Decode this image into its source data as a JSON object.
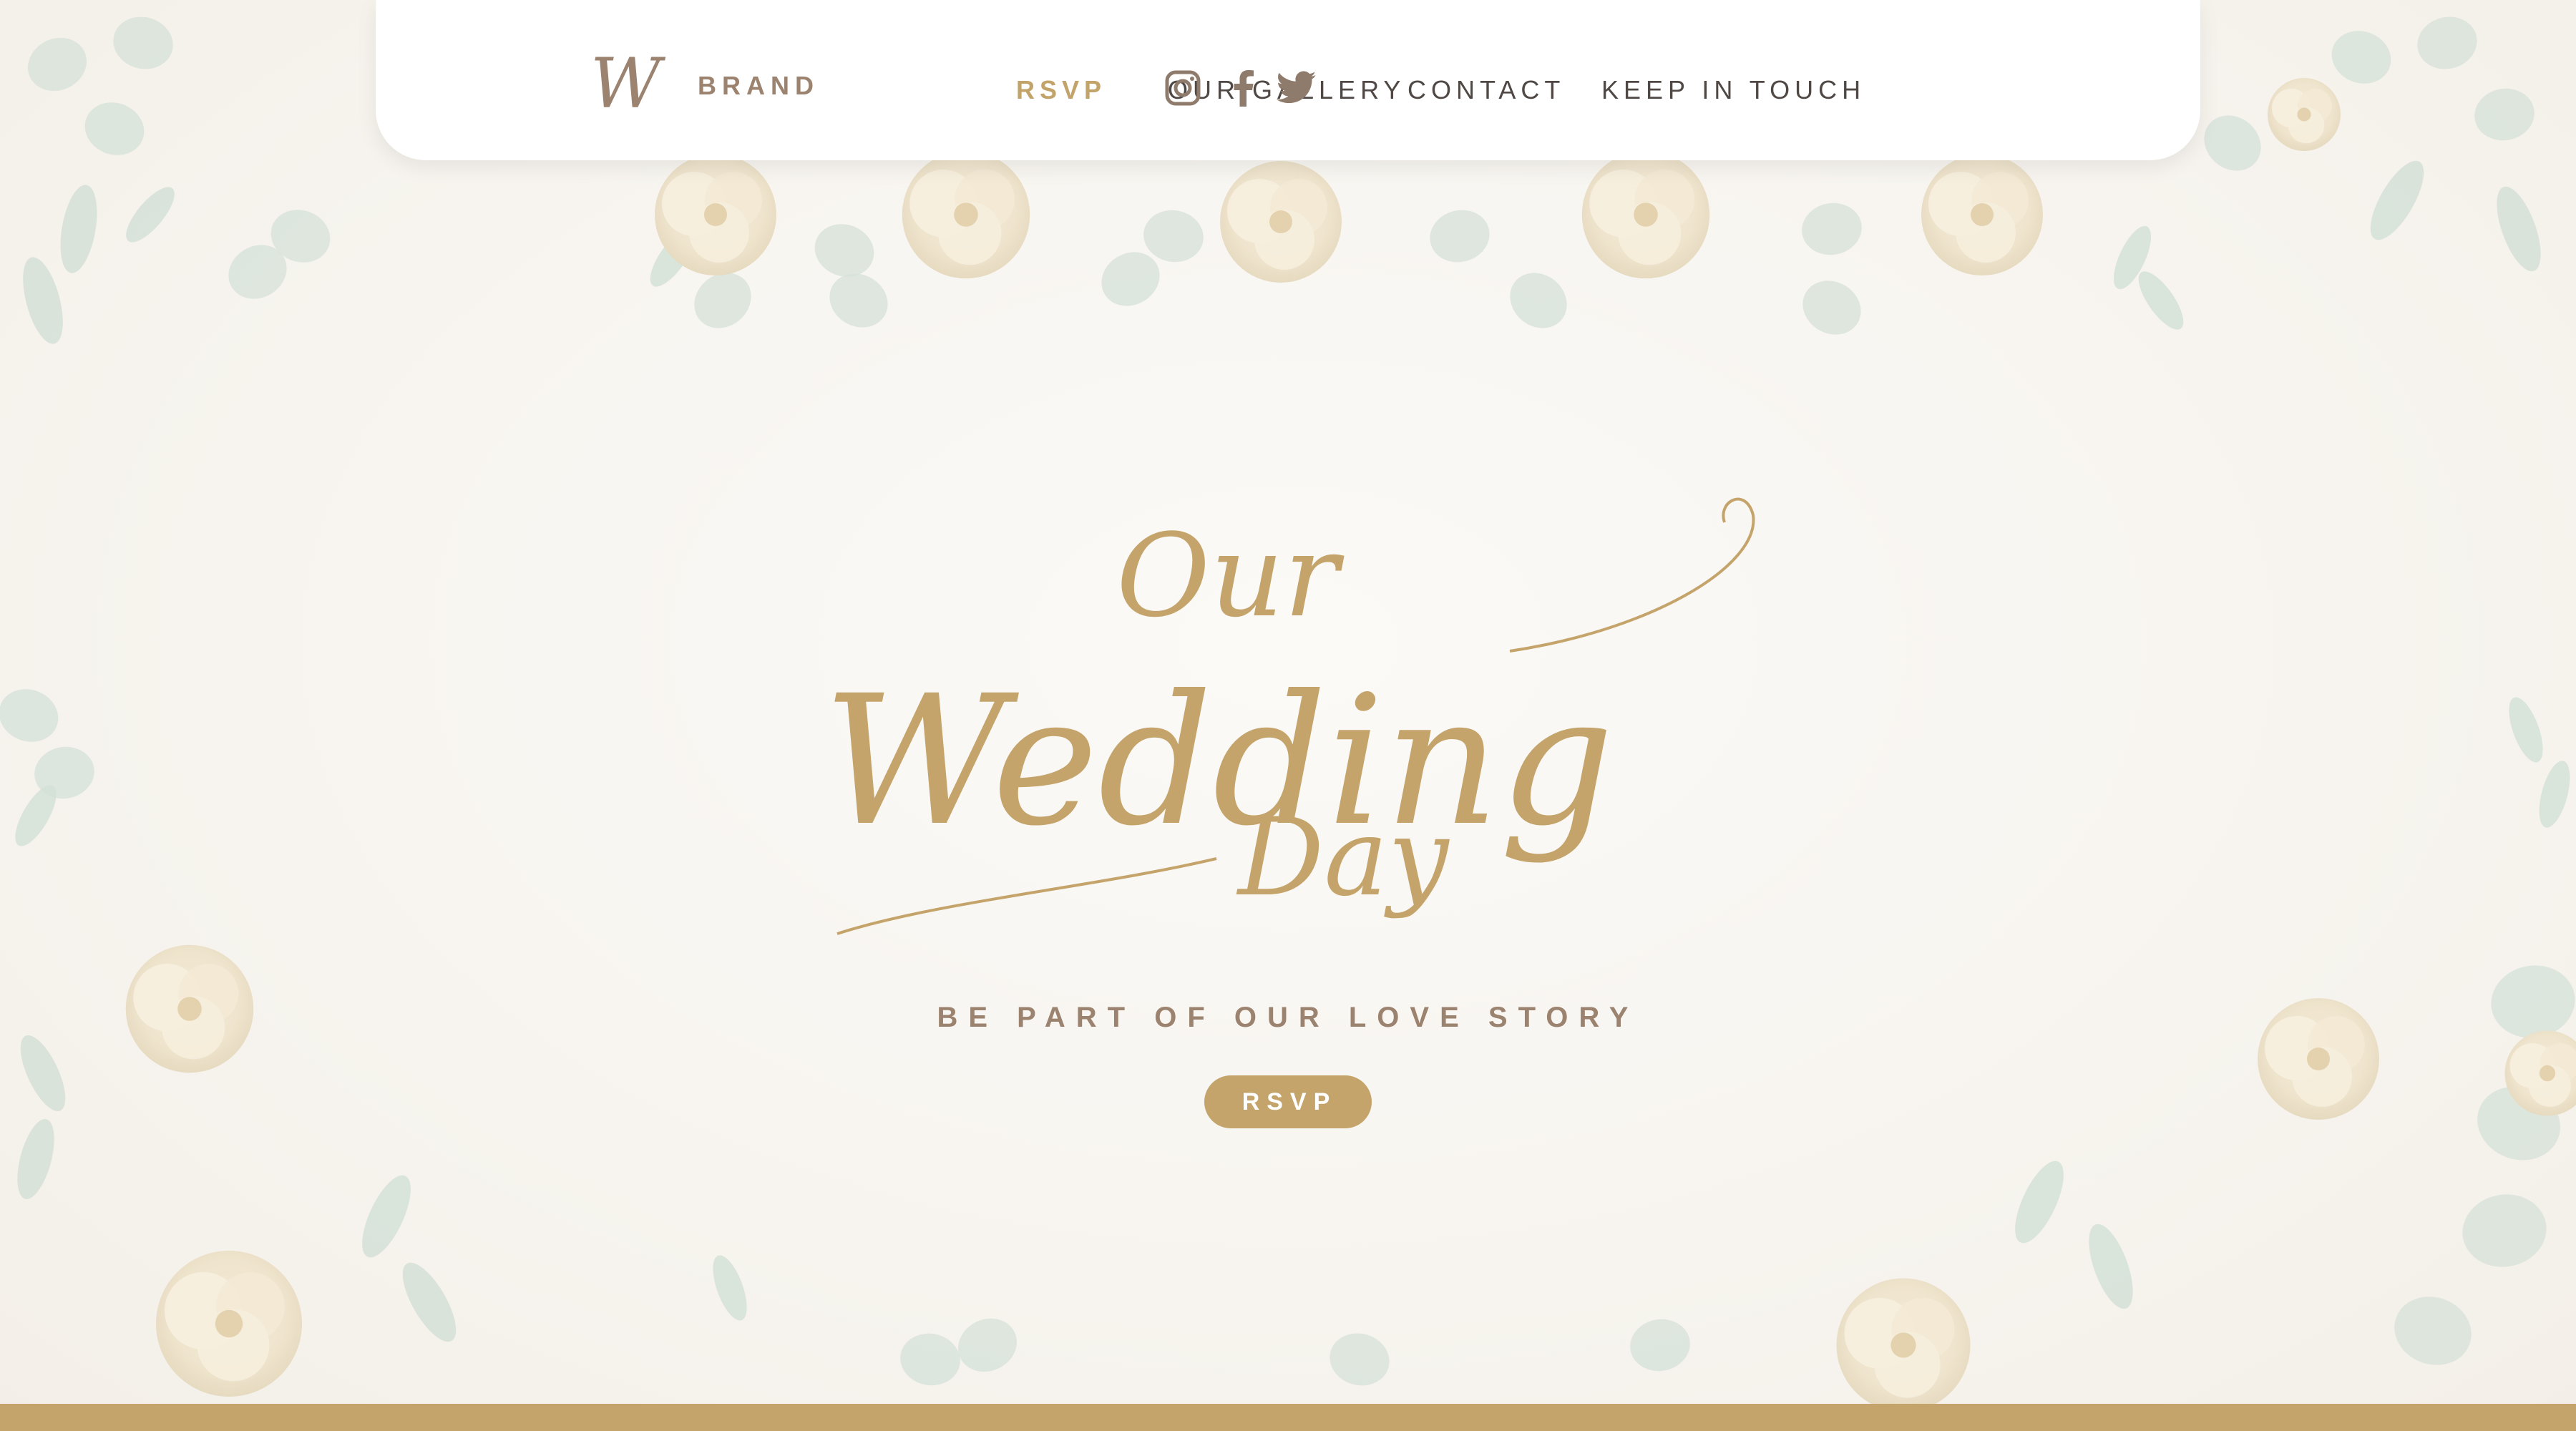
{
  "header": {
    "brand": {
      "logo_letter": "W",
      "text": "BRAND"
    },
    "nav": [
      {
        "label": "RSVP",
        "active": true
      },
      {
        "label": "OUR GALLERY",
        "active": false
      },
      {
        "label": "CONTACT",
        "active": false
      },
      {
        "label": "KEEP IN TOUCH",
        "active": false
      }
    ],
    "social": [
      "instagram-icon",
      "facebook-icon",
      "twitter-icon"
    ]
  },
  "hero": {
    "title_line1": "Our",
    "title_line2": "Wedding",
    "title_line3": "Day",
    "tagline": "BE PART OF OUR LOVE STORY",
    "cta_label": "RSVP"
  },
  "colors": {
    "gold": "#c4a46a",
    "brown": "#9b8370",
    "text": "#4f4845",
    "background": "#f8f6f2",
    "leaf": "#cfdcd3",
    "flower": "#efe6d2"
  }
}
